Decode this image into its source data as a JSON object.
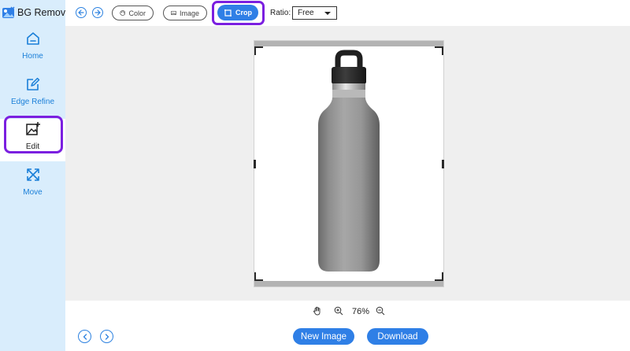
{
  "app": {
    "name": "BG Remover"
  },
  "sidebar": {
    "items": [
      {
        "label": "Home",
        "icon": "home-icon"
      },
      {
        "label": "Edge Refine",
        "icon": "edge-refine-icon"
      },
      {
        "label": "Edit",
        "icon": "edit-image-icon",
        "active": true
      },
      {
        "label": "Move",
        "icon": "move-icon"
      }
    ]
  },
  "toolbar": {
    "undo_icon": "undo-icon",
    "redo_icon": "redo-icon",
    "color_label": "Color",
    "image_label": "Image",
    "crop_label": "Crop",
    "ratio_label": "Ratio:",
    "ratio_value": "Free"
  },
  "zoom": {
    "level": "76%"
  },
  "actions": {
    "new_image_label": "New Image",
    "download_label": "Download"
  },
  "colors": {
    "accent": "#2f7fe6",
    "sidebar_bg": "#d9edfc",
    "highlight": "#7b1fe0",
    "canvas_bg": "#efefef"
  }
}
